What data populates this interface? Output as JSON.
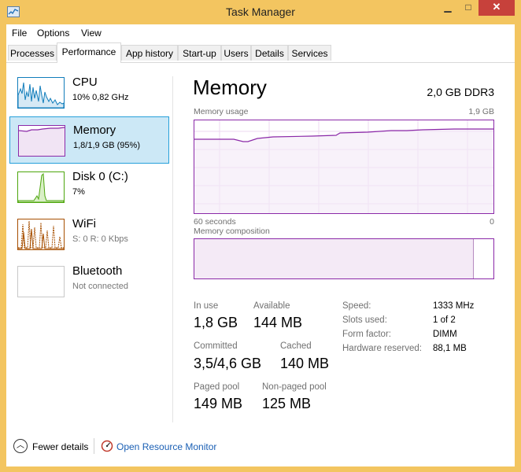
{
  "window": {
    "title": "Task Manager",
    "minimize": "▁",
    "maximize": "□",
    "close": "✕"
  },
  "menu": [
    "File",
    "Options",
    "View"
  ],
  "tabs": [
    "Processes",
    "Performance",
    "App history",
    "Start-up",
    "Users",
    "Details",
    "Services"
  ],
  "active_tab": "Performance",
  "sidebar": [
    {
      "title": "CPU",
      "subtitle": "10% 0,82 GHz",
      "icon": "cpu-graph-icon"
    },
    {
      "title": "Memory",
      "subtitle": "1,8/1,9 GB (95%)",
      "icon": "memory-graph-icon",
      "selected": true
    },
    {
      "title": "Disk 0 (C:)",
      "subtitle": "7%",
      "icon": "disk-graph-icon"
    },
    {
      "title": "WiFi",
      "subtitle": "S: 0 R: 0 Kbps",
      "icon": "wifi-graph-icon"
    },
    {
      "title": "Bluetooth",
      "subtitle": "Not connected",
      "icon": "bluetooth-graph-icon"
    }
  ],
  "memory": {
    "heading": "Memory",
    "spec": "2,0 GB DDR3",
    "usage_label": "Memory usage",
    "usage_max": "1,9 GB",
    "time_left": "60 seconds",
    "time_right": "0",
    "composition_label": "Memory composition",
    "in_use_fraction": 0.935,
    "stats": {
      "in_use_label": "In use",
      "in_use": "1,8 GB",
      "available_label": "Available",
      "available": "144 MB",
      "committed_label": "Committed",
      "committed": "3,5/4,6 GB",
      "cached_label": "Cached",
      "cached": "140 MB",
      "paged_label": "Paged pool",
      "paged": "149 MB",
      "nonpaged_label": "Non-paged pool",
      "nonpaged": "125 MB"
    },
    "props": [
      {
        "label": "Speed:",
        "value": "1333 MHz"
      },
      {
        "label": "Slots used:",
        "value": "1 of 2"
      },
      {
        "label": "Form factor:",
        "value": "DIMM"
      },
      {
        "label": "Hardware reserved:",
        "value": "88,1 MB"
      }
    ]
  },
  "footer": {
    "fewer_details": "Fewer details",
    "resource_monitor": "Open Resource Monitor"
  },
  "colors": {
    "memory_accent": "#8b29a8",
    "cpu_accent": "#117dbb",
    "disk_accent": "#4da60c",
    "wifi_accent": "#a74f01",
    "selected_bg": "#cce8f6",
    "link": "#1a5fb4"
  }
}
